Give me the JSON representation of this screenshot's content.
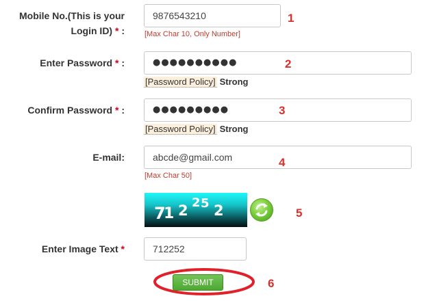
{
  "form": {
    "mobile": {
      "label_line1": "Mobile No.(This is your",
      "label_line2": "Login ID)",
      "required_marker": "*",
      "separator": ":",
      "value": "9876543210",
      "hint": "[Max Char 10, Only Number]",
      "step": "1"
    },
    "password": {
      "label": "Enter Password",
      "required_marker": "*",
      "separator": ":",
      "masked_value": "●●●●●●●●●●",
      "policy_link": "[Password Policy]",
      "strength": "Strong",
      "step": "2"
    },
    "confirm_password": {
      "label": "Confirm Password",
      "required_marker": "*",
      "separator": ":",
      "masked_value": "●●●●●●●●●",
      "policy_link": "[Password Policy]",
      "strength": "Strong",
      "step": "3"
    },
    "email": {
      "label": "E-mail:",
      "value": "abcde@gmail.com",
      "hint": "[Max Char 50]",
      "step": "4"
    },
    "captcha": {
      "chars": [
        "7",
        "1",
        "2",
        "2",
        "5",
        "2"
      ],
      "step": "5",
      "refresh_icon": "refresh-icon"
    },
    "image_text": {
      "label": "Enter Image Text",
      "required_marker": "*",
      "value": "712252"
    },
    "submit": {
      "label": "SUBMIT",
      "step": "6",
      "highlight_color": "#e0212b"
    }
  }
}
